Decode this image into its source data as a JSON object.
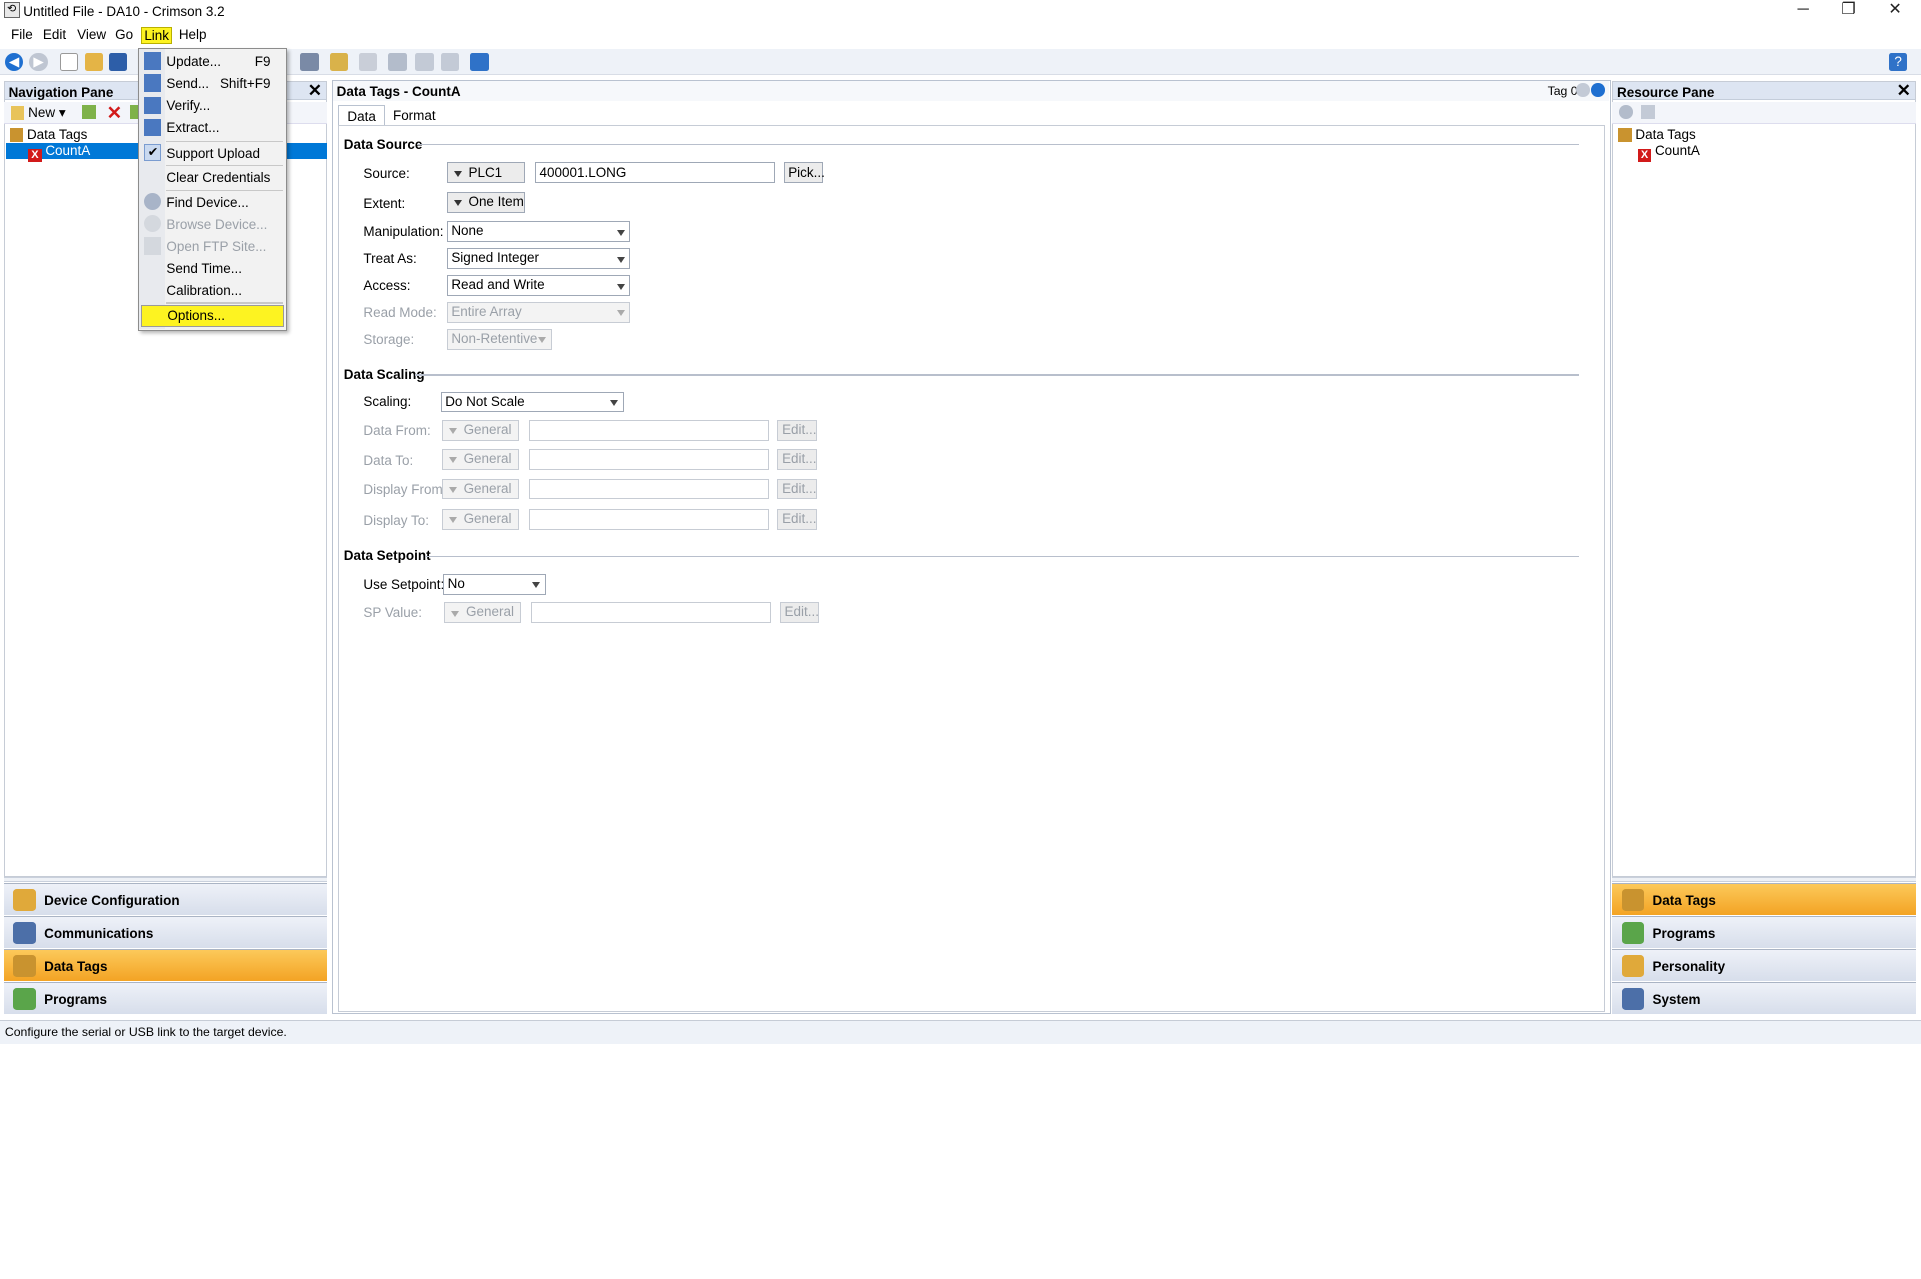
{
  "window": {
    "title": "Untitled File - DA10 - Crimson 3.2",
    "min": "─",
    "restore": "❐",
    "close": "✕"
  },
  "menubar": {
    "items": [
      "File",
      "Edit",
      "View",
      "Go",
      "Link",
      "Help"
    ]
  },
  "nav": {
    "title": "Navigation Pane",
    "new_label": "New",
    "tree_root": "Data Tags",
    "tree_child": "CountA"
  },
  "nav_bottom": [
    "Device Configuration",
    "Communications",
    "Data Tags",
    "Programs"
  ],
  "editor": {
    "title": "Data Tags - CountA",
    "tag_label": "Tag 0",
    "tabs": [
      "Data",
      "Format"
    ]
  },
  "data_source": {
    "heading": "Data Source",
    "source_label": "Source:",
    "source_device": "PLC1",
    "source_value": "400001.LONG",
    "pick": "Pick...",
    "extent_label": "Extent:",
    "extent_value": "One Item",
    "manip_label": "Manipulation:",
    "manip_value": "None",
    "treat_label": "Treat As:",
    "treat_value": "Signed Integer",
    "access_label": "Access:",
    "access_value": "Read and Write",
    "readmode_label": "Read Mode:",
    "readmode_value": "Entire Array",
    "storage_label": "Storage:",
    "storage_value": "Non-Retentive"
  },
  "data_scaling": {
    "heading": "Data Scaling",
    "scaling_label": "Scaling:",
    "scaling_value": "Do Not Scale",
    "rows": [
      {
        "label": "Data From:",
        "type": "General",
        "edit": "Edit..."
      },
      {
        "label": "Data To:",
        "type": "General",
        "edit": "Edit..."
      },
      {
        "label": "Display From:",
        "type": "General",
        "edit": "Edit..."
      },
      {
        "label": "Display To:",
        "type": "General",
        "edit": "Edit..."
      }
    ]
  },
  "data_setpoint": {
    "heading": "Data Setpoint",
    "use_label": "Use Setpoint:",
    "use_value": "No",
    "sp_label": "SP Value:",
    "sp_type": "General",
    "sp_edit": "Edit..."
  },
  "resource": {
    "title": "Resource Pane",
    "tree_root": "Data Tags",
    "tree_child": "CountA"
  },
  "res_bottom": [
    "Data Tags",
    "Programs",
    "Personality",
    "System"
  ],
  "link_menu": {
    "items": [
      {
        "label": "Update...",
        "shortcut": "F9"
      },
      {
        "label": "Send...",
        "shortcut": "Shift+F9"
      },
      {
        "label": "Verify...",
        "shortcut": ""
      },
      {
        "label": "Extract...",
        "shortcut": ""
      },
      {
        "label": "Support Upload",
        "shortcut": ""
      },
      {
        "label": "Clear Credentials",
        "shortcut": ""
      },
      {
        "label": "Find Device...",
        "shortcut": ""
      },
      {
        "label": "Browse Device...",
        "shortcut": ""
      },
      {
        "label": "Open FTP Site...",
        "shortcut": ""
      },
      {
        "label": "Send Time...",
        "shortcut": ""
      },
      {
        "label": "Calibration...",
        "shortcut": ""
      },
      {
        "label": "Options...",
        "shortcut": ""
      }
    ]
  },
  "status": {
    "text": "Configure the serial or USB link to the target device."
  },
  "colors": {
    "accent": "#0078d7",
    "highlight": "#fdf321",
    "active_tab": "#f3a324"
  }
}
